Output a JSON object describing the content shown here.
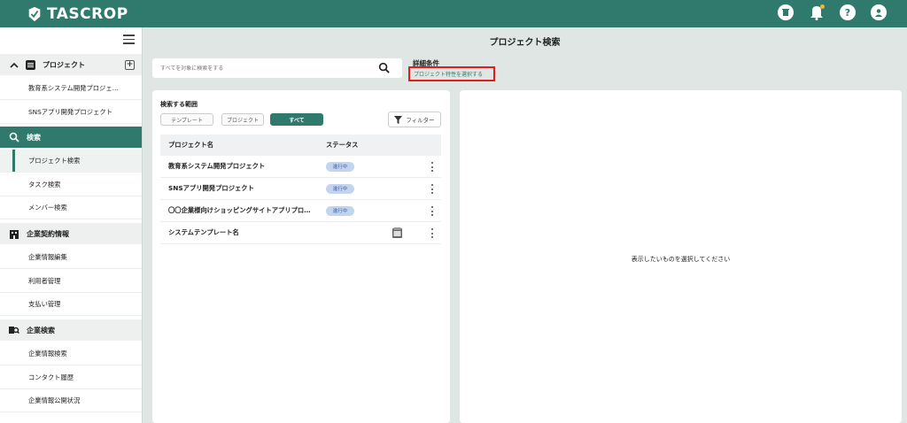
{
  "app": {
    "name": "TASCROP"
  },
  "header": {
    "icons": [
      "trash-icon",
      "bell-icon",
      "help-icon",
      "user-icon"
    ],
    "accent": "#2f7a6c"
  },
  "sidebar": {
    "project_section": "プロジェクト",
    "project_items": [
      "教育系システム開発プロジェ…",
      "SNSアプリ開発プロジェクト"
    ],
    "search_section": "検索",
    "search_items": [
      "プロジェクト検索",
      "タスク検索",
      "メンバー検索"
    ],
    "contract_section": "企業契約情報",
    "contract_items": [
      "企業情報編集",
      "利用者管理",
      "支払い管理"
    ],
    "company_section": "企業検索",
    "company_items": [
      "企業情報検索",
      "コンタクト履歴",
      "企業情報公開状況"
    ]
  },
  "main": {
    "title": "プロジェクト検索",
    "search_placeholder": "すべてを対象に検索をする",
    "detail_label": "詳細条件",
    "detail_link": "プロジェクト特性を選択する",
    "scope_label": "検索する範囲",
    "scope_chips": [
      "テンプレート",
      "プロジェクト",
      "すべて"
    ],
    "filter_label": "フィルター",
    "table_headers": [
      "プロジェクト名",
      "ステータス"
    ],
    "rows": [
      {
        "name": "教育系システム開発プロジェクト",
        "status": "進行中"
      },
      {
        "name": "SNSアプリ開発プロジェクト",
        "status": "進行中"
      },
      {
        "name": "〇〇企業様向けショッピングサイトアプリプロ…",
        "status": "進行中"
      },
      {
        "name": "システムテンプレート名",
        "status": ""
      }
    ],
    "empty_message": "表示したいものを選択してください"
  }
}
